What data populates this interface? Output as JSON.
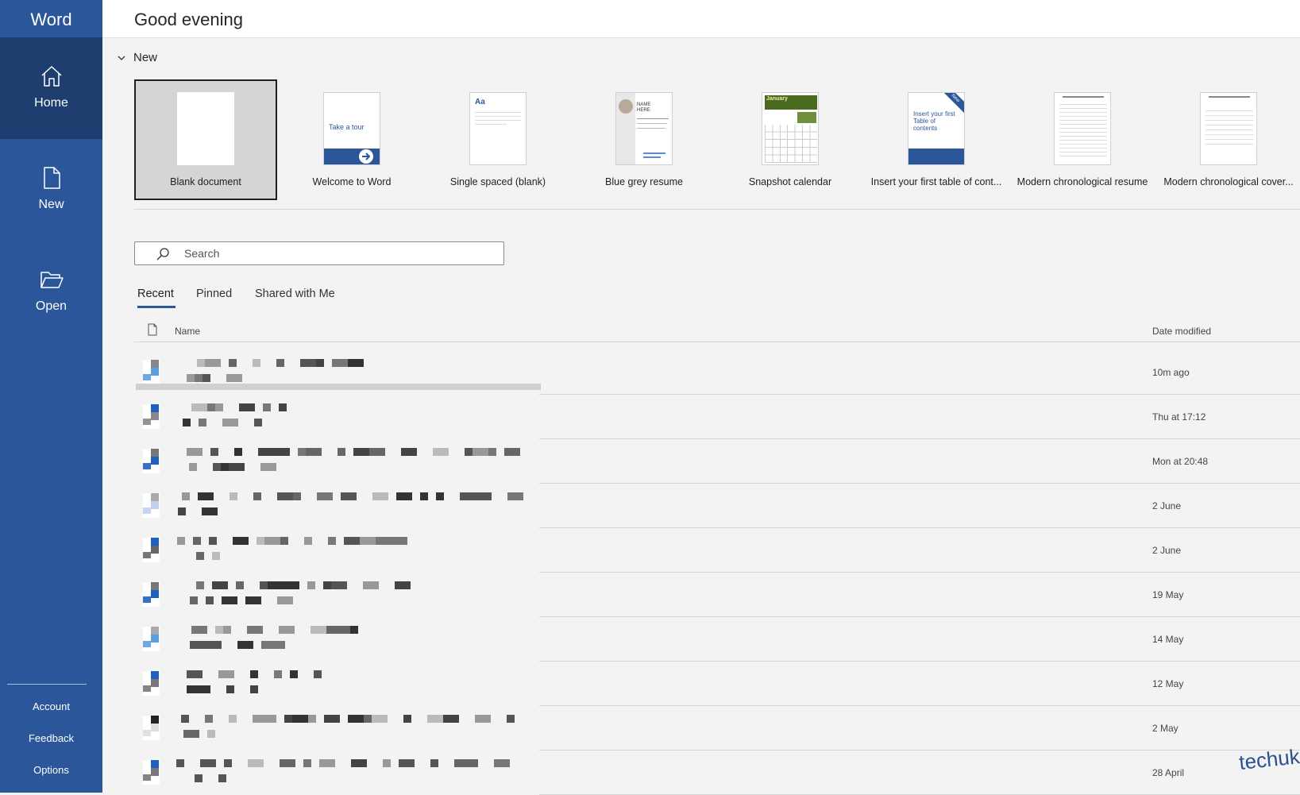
{
  "app": {
    "title": "Word"
  },
  "sidebar": {
    "nav": [
      {
        "label": "Home",
        "icon": "home-icon"
      },
      {
        "label": "New",
        "icon": "new-document-icon"
      },
      {
        "label": "Open",
        "icon": "folder-open-icon"
      }
    ],
    "footer": [
      {
        "label": "Account"
      },
      {
        "label": "Feedback"
      },
      {
        "label": "Options"
      }
    ]
  },
  "greeting": "Good evening",
  "new_section": {
    "title": "New",
    "templates": [
      {
        "label": "Blank document"
      },
      {
        "label": "Welcome to Word",
        "thumb_text": "Take a tour"
      },
      {
        "label": "Single spaced (blank)",
        "thumb_text": "Aa"
      },
      {
        "label": "Blue grey resume",
        "thumb_text": "NAME HERE"
      },
      {
        "label": "Snapshot calendar",
        "thumb_text": "January"
      },
      {
        "label": "Insert your first table of cont...",
        "thumb_text": "Insert your first Table of contents",
        "badge": "New"
      },
      {
        "label": "Modern chronological resume"
      },
      {
        "label": "Modern chronological cover..."
      }
    ]
  },
  "search": {
    "placeholder": "Search"
  },
  "tabs": [
    {
      "label": "Recent"
    },
    {
      "label": "Pinned"
    },
    {
      "label": "Shared with Me"
    }
  ],
  "files": {
    "header": {
      "name": "Name",
      "date": "Date modified"
    },
    "rows": [
      {
        "date": "10m ago"
      },
      {
        "date": "Thu at 17:12"
      },
      {
        "date": "Mon at 20:48"
      },
      {
        "date": "2 June"
      },
      {
        "date": "2 June"
      },
      {
        "date": "19 May"
      },
      {
        "date": "14 May"
      },
      {
        "date": "12 May"
      },
      {
        "date": "2 May"
      },
      {
        "date": "28 April"
      }
    ]
  },
  "watermark": "techukraine.net",
  "colors": {
    "accent": "#2b579a",
    "accent_dark": "#1e3e6f",
    "background": "#f3f3f3"
  }
}
